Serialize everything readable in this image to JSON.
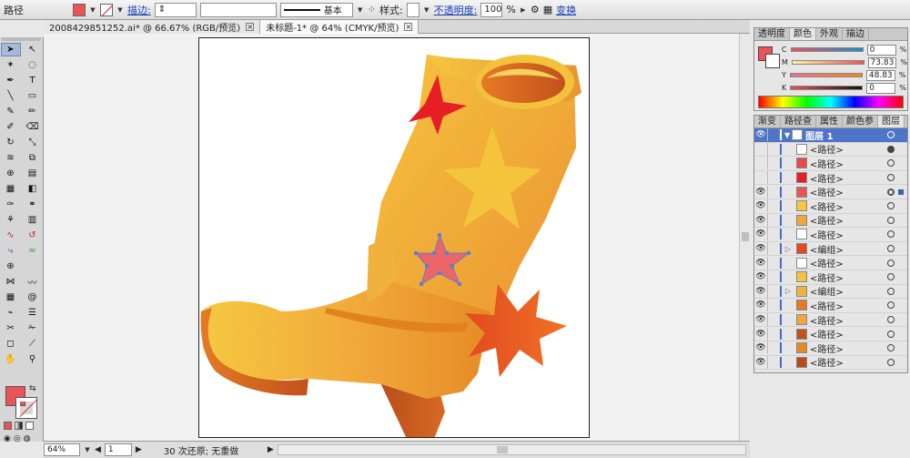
{
  "control_bar": {
    "object_type": "路径",
    "stroke_label": "描边:",
    "style_label": "样式:",
    "stroke_profile": "基本",
    "opacity_label": "不透明度:",
    "opacity_value": "100",
    "opacity_unit": "%",
    "transform_label": "变换",
    "fill_color": "#ea5456"
  },
  "tabs": [
    {
      "label": "2008429851252.ai* @ 66.67% (RGB/预览)"
    },
    {
      "label": "未标题-1* @ 64% (CMYK/预览)"
    }
  ],
  "color_panel": {
    "tabs": [
      "透明度",
      "颜色",
      "外观",
      "描边"
    ],
    "active_tab": "颜色",
    "channels": [
      {
        "name": "C",
        "value": "0"
      },
      {
        "name": "M",
        "value": "73.83"
      },
      {
        "name": "Y",
        "value": "48.83"
      },
      {
        "name": "K",
        "value": "0"
      }
    ],
    "unit": "%"
  },
  "layers_panel": {
    "tabs": [
      "渐变",
      "路径查",
      "属性",
      "颜色参",
      "图层"
    ],
    "active_tab": "图层",
    "top_layer": "图层 1",
    "items": [
      {
        "label": "<路径>",
        "eye": false,
        "expand": false,
        "dot": "filled"
      },
      {
        "label": "<路径>",
        "eye": false,
        "expand": false,
        "dot": "empty"
      },
      {
        "label": "<路径>",
        "eye": false,
        "expand": false,
        "dot": "empty"
      },
      {
        "label": "<路径>",
        "eye": true,
        "expand": false,
        "dot": "selected"
      },
      {
        "label": "<路径>",
        "eye": true,
        "expand": false,
        "dot": "empty"
      },
      {
        "label": "<路径>",
        "eye": true,
        "expand": false,
        "dot": "empty"
      },
      {
        "label": "<路径>",
        "eye": true,
        "expand": false,
        "dot": "empty"
      },
      {
        "label": "<编组>",
        "eye": true,
        "expand": true,
        "dot": "empty"
      },
      {
        "label": "<路径>",
        "eye": true,
        "expand": false,
        "dot": "empty"
      },
      {
        "label": "<路径>",
        "eye": true,
        "expand": false,
        "dot": "empty"
      },
      {
        "label": "<编组>",
        "eye": true,
        "expand": true,
        "dot": "empty"
      },
      {
        "label": "<路径>",
        "eye": true,
        "expand": false,
        "dot": "empty"
      },
      {
        "label": "<路径>",
        "eye": true,
        "expand": false,
        "dot": "empty"
      },
      {
        "label": "<路径>",
        "eye": true,
        "expand": false,
        "dot": "empty"
      },
      {
        "label": "<路径>",
        "eye": true,
        "expand": false,
        "dot": "empty"
      },
      {
        "label": "<路径>",
        "eye": true,
        "expand": false,
        "dot": "empty"
      }
    ]
  },
  "status_bar": {
    "zoom": "64%",
    "artboard": "1",
    "undo_text": "30 次还原; 无重做"
  },
  "tools": {
    "fill_color": "#ea5456",
    "stroke": "none"
  }
}
